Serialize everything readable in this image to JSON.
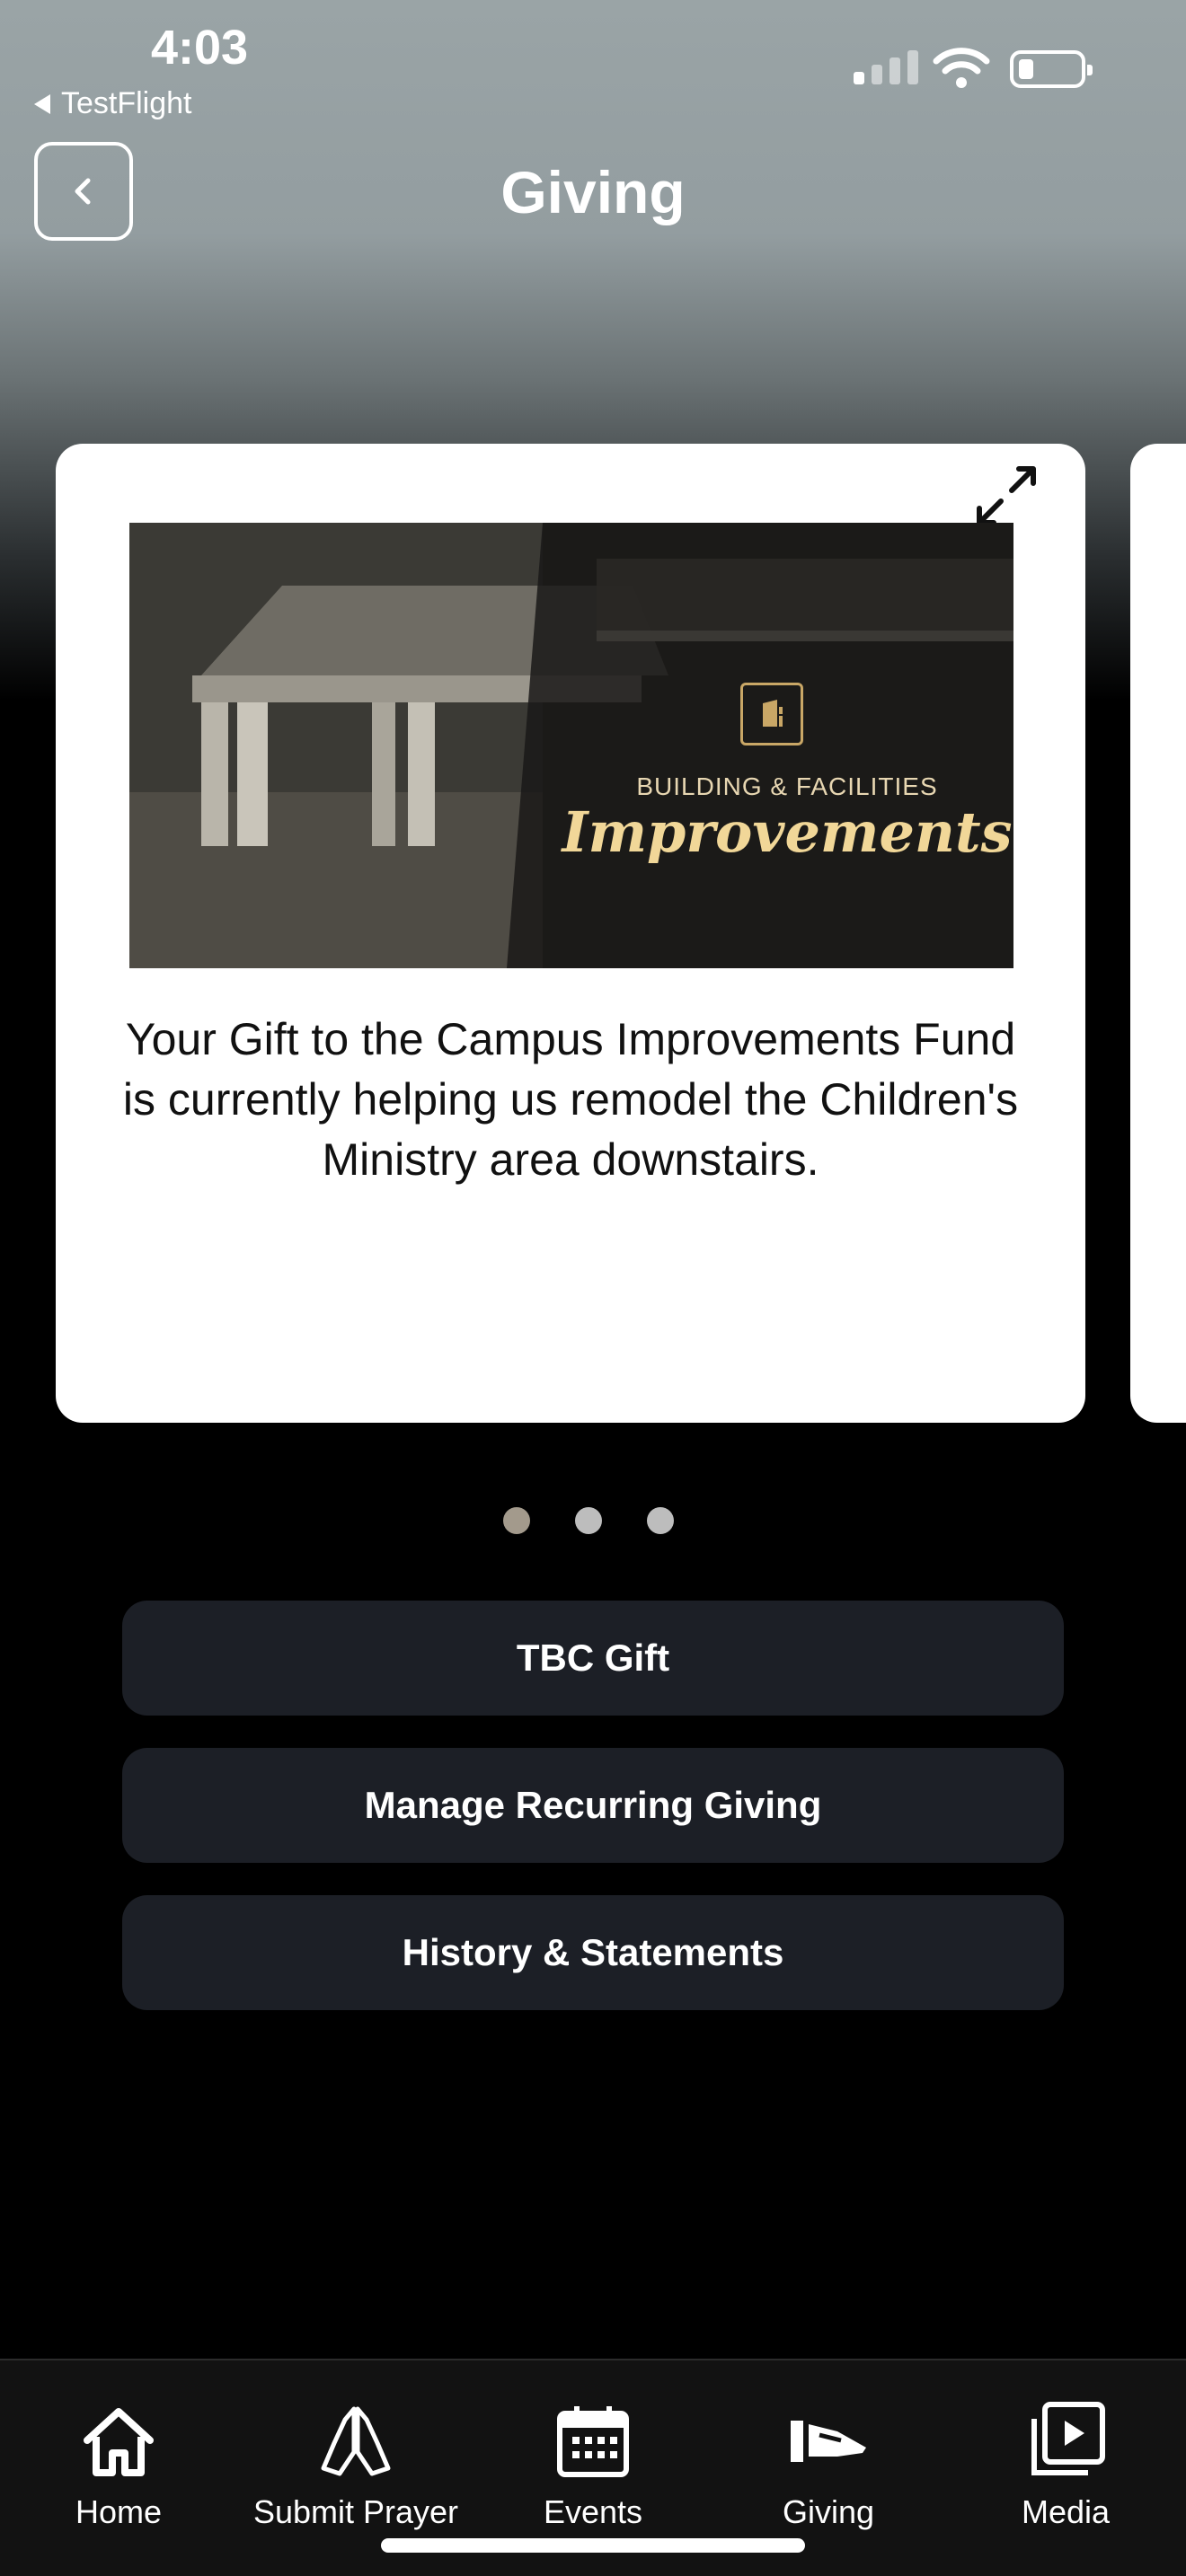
{
  "status_bar": {
    "time": "4:03",
    "back_app": "TestFlight"
  },
  "header": {
    "title": "Giving"
  },
  "carousel": {
    "slides": [
      {
        "banner_subtitle": "BUILDING & FACILITIES",
        "banner_title": "Improvements",
        "description": "Your Gift to the Campus Improvements Fund is currently helping us remodel the Children's Ministry area downstairs."
      }
    ],
    "dot_count": 3,
    "active_index": 0
  },
  "actions": [
    {
      "label": "TBC Gift"
    },
    {
      "label": "Manage Recurring Giving"
    },
    {
      "label": "History & Statements"
    }
  ],
  "tabs": [
    {
      "label": "Home",
      "icon": "home-icon"
    },
    {
      "label": "Submit Prayer",
      "icon": "praying-hands-icon"
    },
    {
      "label": "Events",
      "icon": "calendar-icon"
    },
    {
      "label": "Giving",
      "icon": "giving-hand-icon",
      "active": true
    },
    {
      "label": "Media",
      "icon": "media-play-icon"
    }
  ],
  "colors": {
    "background": "#000000",
    "header_gradient_top": "#9aa4a6",
    "button_bg": "#1c1f26",
    "banner_gold": "#f1d798",
    "tabbar_bg": "#121212"
  }
}
